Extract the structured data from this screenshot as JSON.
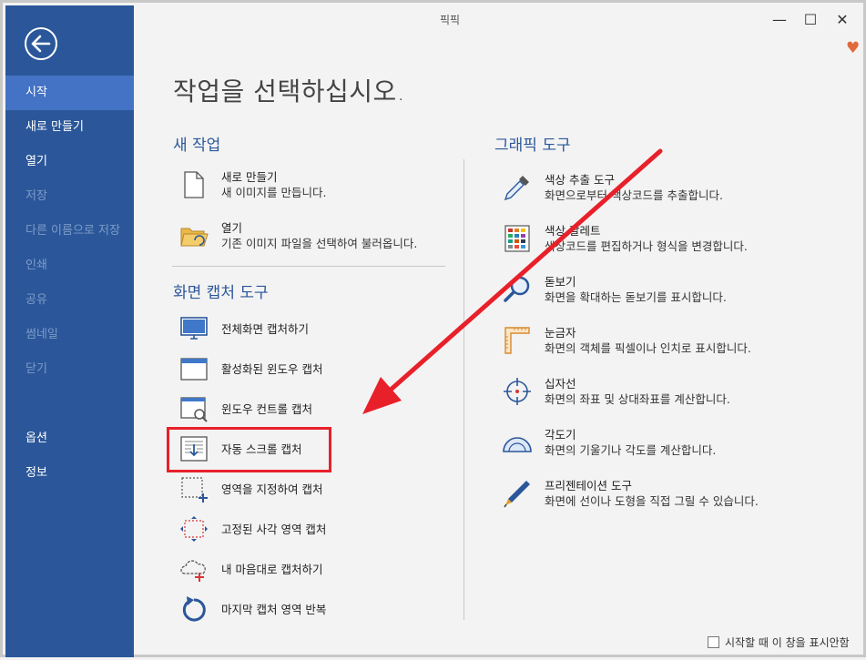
{
  "window": {
    "title": "픽픽",
    "minimize": "—",
    "maximize": "☐",
    "close": "✕",
    "heart": "♥"
  },
  "sidebar": {
    "items": [
      {
        "label": "시작"
      },
      {
        "label": "새로 만들기"
      },
      {
        "label": "열기"
      },
      {
        "label": "저장"
      },
      {
        "label": "다른 이름으로 저장"
      },
      {
        "label": "인쇄"
      },
      {
        "label": "공유"
      },
      {
        "label": "썸네일"
      },
      {
        "label": "닫기"
      },
      {
        "label": "옵션"
      },
      {
        "label": "정보"
      }
    ]
  },
  "main": {
    "title": "작업을 선택하십시오.",
    "new_task": {
      "title": "새 작업",
      "items": [
        {
          "label": "새로 만들기",
          "desc": "새 이미지를 만듭니다.",
          "icon": "new-file-icon"
        },
        {
          "label": "열기",
          "desc": "기존 이미지 파일을 선택하여 불러옵니다.",
          "icon": "open-folder-icon"
        }
      ]
    },
    "capture": {
      "title": "화면 캡처 도구",
      "items": [
        {
          "label": "전체화면 캡처하기",
          "icon": "monitor-icon"
        },
        {
          "label": "활성화된 윈도우 캡처",
          "icon": "window-icon"
        },
        {
          "label": "윈도우 컨트롤 캡처",
          "icon": "window-control-icon"
        },
        {
          "label": "자동 스크롤 캡처",
          "icon": "scroll-capture-icon"
        },
        {
          "label": "영역을 지정하여 캡처",
          "icon": "region-icon"
        },
        {
          "label": "고정된 사각 영역 캡처",
          "icon": "fixed-region-icon"
        },
        {
          "label": "내 마음대로 캡처하기",
          "icon": "freehand-icon"
        },
        {
          "label": "마지막 캡처 영역 반복",
          "icon": "repeat-icon"
        }
      ]
    },
    "graphic": {
      "title": "그래픽 도구",
      "items": [
        {
          "label": "색상 추출 도구",
          "desc": "화면으로부터 색상코드를 추출합니다.",
          "icon": "eyedropper-icon"
        },
        {
          "label": "색상 팔레트",
          "desc": "색상코드를 편집하거나 형식을 변경합니다.",
          "icon": "palette-icon"
        },
        {
          "label": "돋보기",
          "desc": "화면을 확대하는 돋보기를 표시합니다.",
          "icon": "magnifier-icon"
        },
        {
          "label": "눈금자",
          "desc": "화면의 객체를 픽셀이나 인치로 표시합니다.",
          "icon": "ruler-icon"
        },
        {
          "label": "십자선",
          "desc": "화면의 좌표 및 상대좌표를 계산합니다.",
          "icon": "crosshair-icon"
        },
        {
          "label": "각도기",
          "desc": "화면의 기울기나 각도를 계산합니다.",
          "icon": "protractor-icon"
        },
        {
          "label": "프리젠테이션 도구",
          "desc": "화면에 선이나 도형을 직접 그릴 수 있습니다.",
          "icon": "pen-icon"
        }
      ]
    }
  },
  "footer": {
    "checkbox_label": "시작할 때 이 창을 표시안함",
    "checked": false
  },
  "colors": {
    "sidebar": "#2b579a",
    "sidebar_active": "#4472c4",
    "accent": "#2b579a",
    "highlight": "#e8202a"
  }
}
